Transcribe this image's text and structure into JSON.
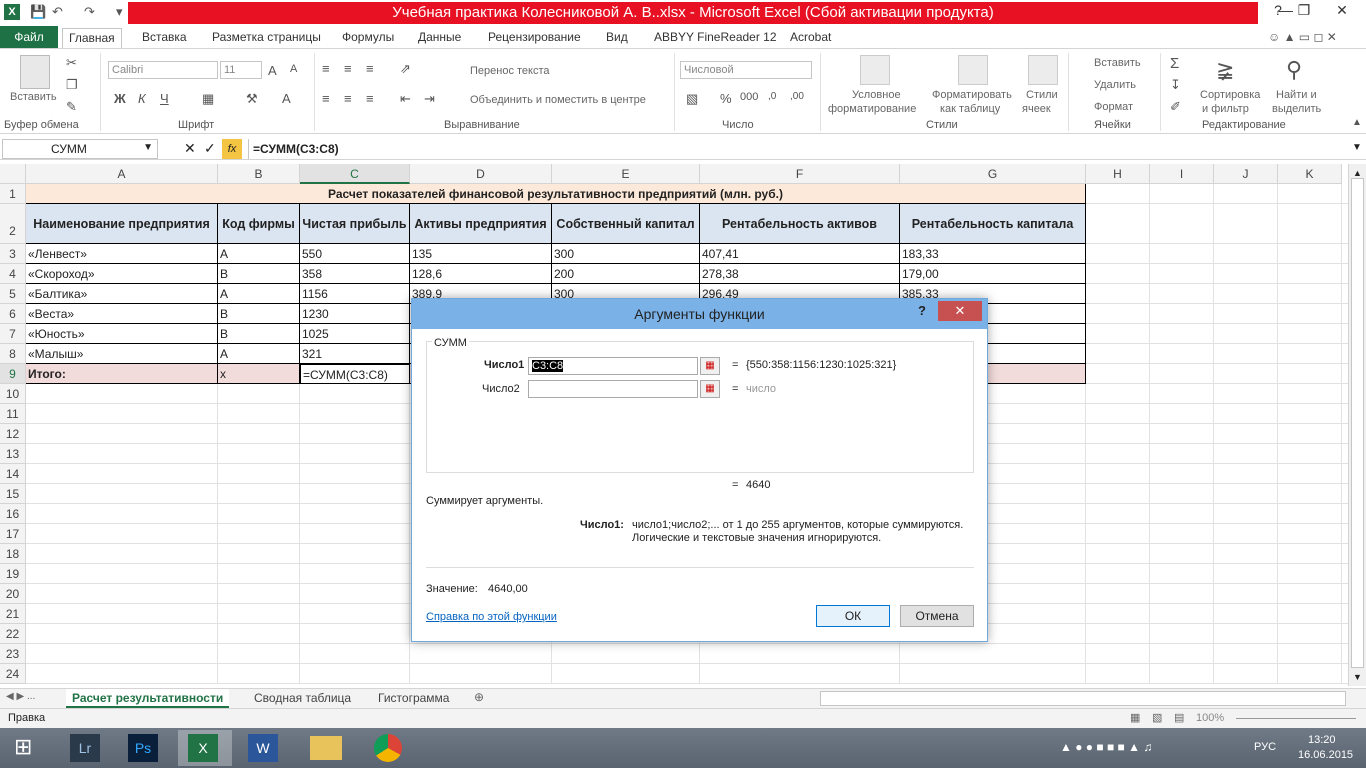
{
  "window": {
    "title": "Учебная практика Колесниковой А. В..xlsx  -  Microsoft Excel (Сбой активации продукта)",
    "accent": "#217346",
    "title_bg": "#e81123"
  },
  "tabs": [
    "Файл",
    "Главная",
    "Вставка",
    "Разметка страницы",
    "Формулы",
    "Данные",
    "Рецензирование",
    "Вид",
    "ABBYY FineReader 12",
    "Acrobat"
  ],
  "ribbon": {
    "clipboard": {
      "paste": "Вставить",
      "label": "Буфер обмена"
    },
    "font": {
      "name": "Calibri",
      "size": "11",
      "label": "Шрифт",
      "bold": "Ж",
      "italic": "К",
      "underline": "Ч"
    },
    "alignment": {
      "wrap": "Перенос текста",
      "merge": "Объединить и поместить в центре",
      "label": "Выравнивание"
    },
    "number": {
      "format": "Числовой",
      "label": "Число",
      "percent": "%",
      "thousands": "000"
    },
    "styles": {
      "conditional": "Условное",
      "conditional2": "форматирование",
      "astable": "Форматировать",
      "astable2": "как таблицу",
      "cellstyles": "Стили",
      "cellstyles2": "ячеек",
      "label": "Стили"
    },
    "cells": {
      "insert": "Вставить",
      "delete": "Удалить",
      "format": "Формат",
      "label": "Ячейки"
    },
    "editing": {
      "sort": "Сортировка",
      "sort2": "и фильтр",
      "find": "Найти и",
      "find2": "выделить",
      "label": "Редактирование"
    }
  },
  "formula_bar": {
    "name_box": "СУММ",
    "formula": "=СУММ(C3:C8)",
    "fx": "fx"
  },
  "columns": [
    "A",
    "B",
    "C",
    "D",
    "E",
    "F",
    "G",
    "H",
    "I",
    "J",
    "K"
  ],
  "rows": [
    "1",
    "2",
    "3",
    "4",
    "5",
    "6",
    "7",
    "8",
    "9",
    "10",
    "11",
    "12",
    "13",
    "14",
    "15",
    "16",
    "17",
    "18",
    "19",
    "20",
    "21",
    "22",
    "23",
    "24"
  ],
  "table": {
    "title": "Расчет показателей финансовой результативности предприятий (млн. руб.)",
    "headers": [
      "Наименование предприятия",
      "Код фирмы",
      "Чистая прибыль",
      "Активы предприятия",
      "Собственный капитал",
      "Рентабельность активов",
      "Рентабельность капитала"
    ],
    "rows": [
      [
        "«Ленвест»",
        "A",
        "550",
        "135",
        "300",
        "407,41",
        "183,33"
      ],
      [
        "«Скороход»",
        "B",
        "358",
        "128,6",
        "200",
        "278,38",
        "179,00"
      ],
      [
        "«Балтика»",
        "A",
        "1156",
        "389,9",
        "300",
        "296,49",
        "385,33"
      ],
      [
        "«Веста»",
        "B",
        "1230",
        "",
        "",
        "",
        ""
      ],
      [
        "«Юность»",
        "B",
        "1025",
        "",
        "",
        "",
        ""
      ],
      [
        "«Малыш»",
        "A",
        "321",
        "",
        "",
        "",
        ""
      ]
    ],
    "total": [
      "Итого:",
      "x",
      "=СУММ(C3:C8)"
    ]
  },
  "dialog": {
    "title": "Аргументы функции",
    "help": "?",
    "close": "✕",
    "func_name": "СУММ",
    "arg1_label": "Число1",
    "arg1_value": "C3:C8",
    "arg1_result": "{550:358:1156:1230:1025:321}",
    "arg2_label": "Число2",
    "arg2_result": "число",
    "eq": "=",
    "total_result": "4640",
    "description": "Суммирует аргументы.",
    "arg_desc_label": "Число1:",
    "arg_desc_line1": "число1;число2;... от 1 до 255 аргументов, которые суммируются.",
    "arg_desc_line2": "Логические и текстовые значения игнорируются.",
    "value_label": "Значение:",
    "value": "4640,00",
    "help_link": "Справка по этой функции",
    "ok": "ОК",
    "cancel": "Отмена"
  },
  "sheets": [
    "Расчет результативности",
    "Сводная таблица",
    "Гистограмма"
  ],
  "status": {
    "mode": "Правка",
    "zoom": "100%"
  },
  "taskbar": {
    "lang": "РУС",
    "time": "13:20",
    "date": "16.06.2015"
  }
}
